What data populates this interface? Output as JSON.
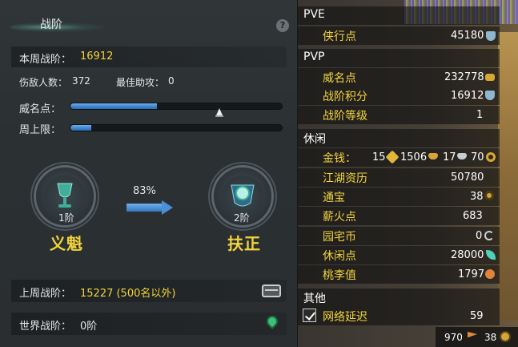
{
  "left": {
    "title": "战阶",
    "help_label": "?",
    "weekly": {
      "label": "本周战阶：",
      "value": "16912"
    },
    "kills": {
      "label": "伤敌人数：",
      "value": "372"
    },
    "assists": {
      "label": "最佳助攻：",
      "value": "0"
    },
    "prestige": {
      "label": "威名点：",
      "progress": 0.41
    },
    "weekly_cap": {
      "label": "周上限：",
      "progress": 0.1
    },
    "current_rank": {
      "level": "1阶",
      "name": "义魁"
    },
    "progress_percent": "83%",
    "next_rank": {
      "level": "2阶",
      "name": "扶正"
    },
    "last_week": {
      "label": "上周战阶：",
      "value": "15227 (500名以外)"
    },
    "world": {
      "label": "世界战阶：",
      "value": "0阶"
    },
    "icons": {
      "chest": "treasure-chest-icon",
      "pin": "location-pin-icon"
    }
  },
  "right": {
    "pve": {
      "title": "PVE",
      "items": [
        {
          "label": "侠行点",
          "value": "45180"
        }
      ]
    },
    "pvp": {
      "title": "PVP",
      "items": [
        {
          "label": "威名点",
          "value": "232778"
        },
        {
          "label": "战阶积分",
          "value": "16912"
        },
        {
          "label": "战阶等级",
          "value": "1"
        }
      ]
    },
    "leisure": {
      "title": "休闲",
      "money": {
        "label": "金钱：",
        "a": "15",
        "b": "1506",
        "c": "17",
        "d": "70"
      },
      "items": [
        {
          "label": "江湖资历",
          "value": "50780"
        },
        {
          "label": "通宝",
          "value": "38"
        },
        {
          "label": "薪火点",
          "value": "683"
        },
        {
          "label": "园宅币",
          "value": "0"
        },
        {
          "label": "休闲点",
          "value": "28000"
        },
        {
          "label": "桃李值",
          "value": "1797"
        }
      ]
    },
    "other": {
      "title": "其他",
      "items": [
        {
          "label": "网络延迟",
          "value": "59"
        }
      ]
    },
    "bottom": {
      "a": "970",
      "b": "38"
    },
    "colors": {
      "label": "#f2d43b",
      "bar": "#3f86cf"
    }
  }
}
